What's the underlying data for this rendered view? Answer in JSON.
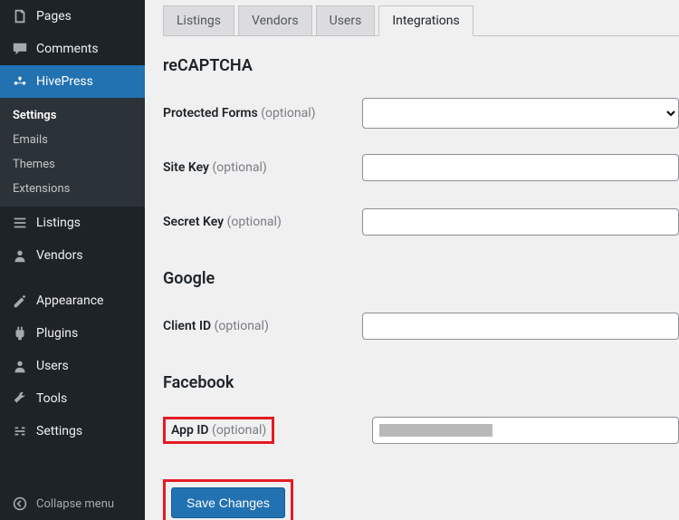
{
  "sidebar": {
    "items": [
      {
        "label": "Pages"
      },
      {
        "label": "Comments"
      },
      {
        "label": "HivePress"
      },
      {
        "label": "Listings"
      },
      {
        "label": "Vendors"
      },
      {
        "label": "Appearance"
      },
      {
        "label": "Plugins"
      },
      {
        "label": "Users"
      },
      {
        "label": "Tools"
      },
      {
        "label": "Settings"
      }
    ],
    "submenu": {
      "items": [
        {
          "label": "Settings"
        },
        {
          "label": "Emails"
        },
        {
          "label": "Themes"
        },
        {
          "label": "Extensions"
        }
      ]
    },
    "collapse_label": "Collapse menu"
  },
  "tabs": {
    "items": [
      {
        "label": "Listings"
      },
      {
        "label": "Vendors"
      },
      {
        "label": "Users"
      },
      {
        "label": "Integrations"
      }
    ]
  },
  "sections": {
    "recaptcha": {
      "title": "reCAPTCHA",
      "protected_forms": {
        "label": "Protected Forms",
        "optional": "(optional)",
        "value": ""
      },
      "site_key": {
        "label": "Site Key",
        "optional": "(optional)",
        "value": ""
      },
      "secret_key": {
        "label": "Secret Key",
        "optional": "(optional)",
        "value": ""
      }
    },
    "google": {
      "title": "Google",
      "client_id": {
        "label": "Client ID",
        "optional": "(optional)",
        "value": ""
      }
    },
    "facebook": {
      "title": "Facebook",
      "app_id": {
        "label": "App ID",
        "optional": "(optional)",
        "value": ""
      }
    }
  },
  "submit": {
    "label": "Save Changes"
  },
  "colors": {
    "accent": "#2271b1",
    "highlight": "#e31b23"
  }
}
